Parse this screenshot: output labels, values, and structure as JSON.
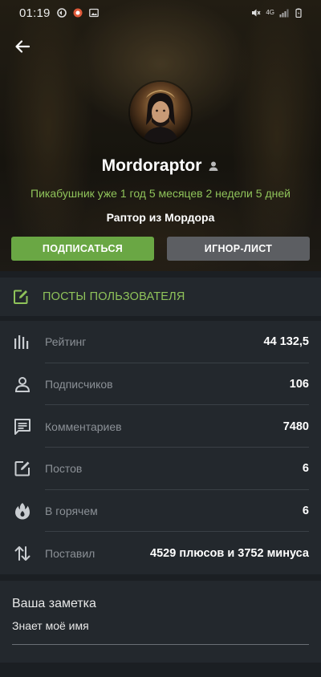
{
  "status_bar": {
    "time": "01:19",
    "network_label": "4G",
    "left_icons": [
      "sync-icon",
      "bug-app-icon",
      "photo-icon"
    ],
    "right_icons": [
      "mute-icon",
      "signal-icon",
      "battery-icon"
    ]
  },
  "profile": {
    "username": "Mordoraptor",
    "since": "Пикабушник уже 1 год 5 месяцев 2 недели 5 дней",
    "tagline": "Раптор из Мордора",
    "subscribe_label": "ПОДПИСАТЬСЯ",
    "ignore_label": "ИГНОР-ЛИСТ"
  },
  "posts_link": {
    "label": "ПОСТЫ ПОЛЬЗОВАТЕЛЯ"
  },
  "stats": [
    {
      "icon": "rating-bars-icon",
      "name": "Рейтинг",
      "value": "44 132,5"
    },
    {
      "icon": "person-icon",
      "name": "Подписчиков",
      "value": "106"
    },
    {
      "icon": "comment-icon",
      "name": "Комментариев",
      "value": "7480"
    },
    {
      "icon": "edit-icon",
      "name": "Постов",
      "value": "6"
    },
    {
      "icon": "flame-icon",
      "name": "В горячем",
      "value": "6"
    },
    {
      "icon": "up-down-arrows-icon",
      "name": "Поставил",
      "value": "4529 плюсов и 3752 минуса"
    }
  ],
  "note": {
    "title": "Ваша заметка",
    "text": "Знает моё имя"
  },
  "colors": {
    "accent_green": "#8fc35a",
    "button_green": "#6aa744",
    "button_gray": "#5c5e62",
    "panel": "#23282d",
    "background": "#1b1f23"
  }
}
